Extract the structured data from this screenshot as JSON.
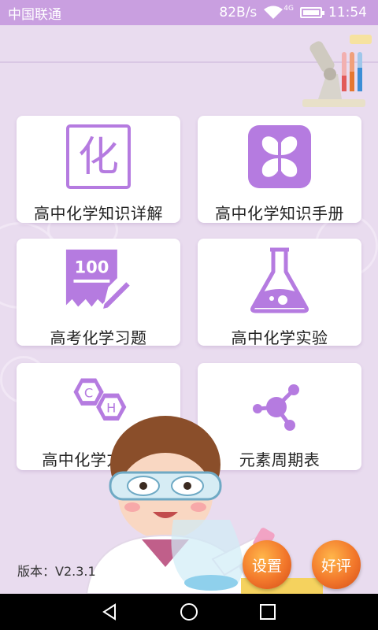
{
  "status": {
    "carrier": "中国联通",
    "speed": "82B/s",
    "network": "4G",
    "time": "11:54"
  },
  "menu": [
    {
      "label": "高中化学知识详解",
      "icon": "hua-character-icon"
    },
    {
      "label": "高中化学知识手册",
      "icon": "clover-book-icon"
    },
    {
      "label": "高考化学习题",
      "icon": "exam-100-icon"
    },
    {
      "label": "高中化学实验",
      "icon": "flask-icon"
    },
    {
      "label": "高中化学方程式",
      "icon": "benzene-ch-icon"
    },
    {
      "label": "元素周期表",
      "icon": "molecule-icon"
    }
  ],
  "exam_score": "100",
  "icon_glyphs": {
    "hua": "化",
    "c": "C",
    "h": "H"
  },
  "footer": {
    "version": "版本：V2.3.1",
    "settings": "设置",
    "rate": "好评"
  },
  "colors": {
    "accent": "#b57be0",
    "statusbar": "#c99fe0",
    "background": "#e9dcef",
    "button": "#f2772b"
  }
}
